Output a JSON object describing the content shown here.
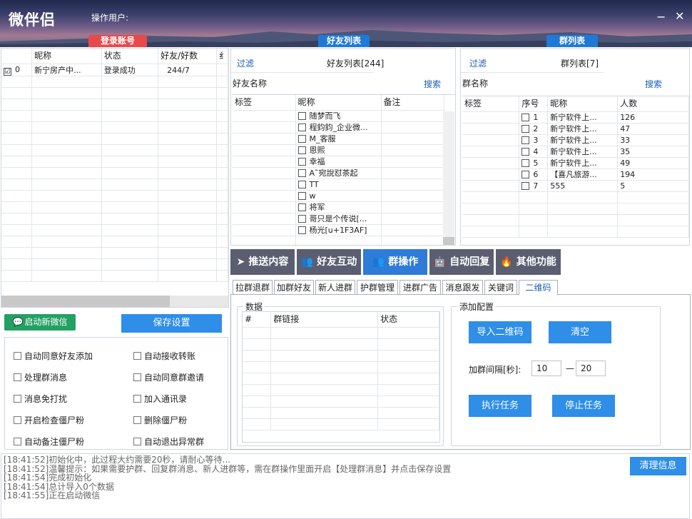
{
  "header": {
    "title": "微伴侣",
    "operator_label": "操作用户:",
    "minimize": "−",
    "close": "✕",
    "login_tab": "登录账号",
    "friends_tab": "好友列表",
    "groups_tab": "群列表"
  },
  "accounts": {
    "columns": [
      "",
      "昵称",
      "状态",
      "好友/好数",
      "纟"
    ],
    "rows": [
      {
        "checked": "☑",
        "index": "0",
        "nickname": "新宁房产中...",
        "status": "登录成功",
        "friends": "244/7"
      }
    ]
  },
  "friends": {
    "filter": "过滤",
    "title": "好友列表[244]",
    "name_label": "好友名称",
    "search": "搜索",
    "columns": [
      "标签",
      "昵称",
      "备注"
    ],
    "rows": [
      "随梦而飞",
      "程鈞鈞_企业微...",
      "M_客服",
      "恩熙",
      "幸福",
      "A˜宛說怼茶起",
      "TT",
      "w",
      "将军",
      "哥只是个传说[...",
      "杨光[u+1F3AF]"
    ]
  },
  "groups": {
    "filter": "过滤",
    "title": "群列表[7]",
    "name_label": "群名称",
    "search": "搜索",
    "columns": [
      "标签",
      "序号",
      "昵称",
      "人数"
    ],
    "rows": [
      {
        "index": "1",
        "name": "新宁软件上...",
        "count": "126"
      },
      {
        "index": "2",
        "name": "新宁软件上...",
        "count": "47"
      },
      {
        "index": "3",
        "name": "新宁软件上...",
        "count": "33"
      },
      {
        "index": "4",
        "name": "新宁软件上...",
        "count": "35"
      },
      {
        "index": "5",
        "name": "新宁软件上...",
        "count": "49"
      },
      {
        "index": "6",
        "name": "【喜凡旅游...",
        "count": "194"
      },
      {
        "index": "7",
        "name": "555",
        "count": "5"
      }
    ]
  },
  "main_tabs": [
    "推送内容",
    "好友互动",
    "群操作",
    "自动回复",
    "其他功能"
  ],
  "sub_tabs": [
    "拉群退群",
    "加群好友",
    "新人进群",
    "护群管理",
    "进群广告",
    "消息跟发",
    "关键词",
    "二维码"
  ],
  "data_group": {
    "title": "数据",
    "columns": [
      "#",
      "群链接",
      "状态"
    ]
  },
  "config_group": {
    "title": "添加配置",
    "import_qr": "导入二维码",
    "clear": "清空",
    "interval_label": "加群间隔[秒]:",
    "interval_min": "10",
    "dash": "—",
    "interval_max": "20",
    "run": "执行任务",
    "stop": "停止任务"
  },
  "left_buttons": {
    "start_wechat": "启动新微信",
    "save_settings": "保存设置"
  },
  "options": [
    "自动同意好友添加",
    "自动接收转账",
    "处理群消息",
    "自动同意群邀请",
    "消息免打扰",
    "加入通讯录",
    "开启检查僵尸粉",
    "删除僵尸粉",
    "自动备注僵尸粉",
    "自动退出异常群"
  ],
  "log": {
    "lines": [
      "[18:41:52]初始化中，此过程大约需要20秒，请耐心等待...",
      "[18:41:52]温馨提示：如果需要护群、回复群消息、新人进群等，需在群操作里面开启【处理群消息】并点击保存设置",
      "[18:41:54]完成初始化",
      "[18:41:54]总计导入0个数据",
      "[18:41:55]正在启动微信"
    ],
    "clear_button": "清理信息"
  },
  "colors": {
    "accent": "#2e7bd8",
    "login_tab": "#e84a4a",
    "start_button": "#23a063",
    "main_tab": "#5a5e70"
  }
}
